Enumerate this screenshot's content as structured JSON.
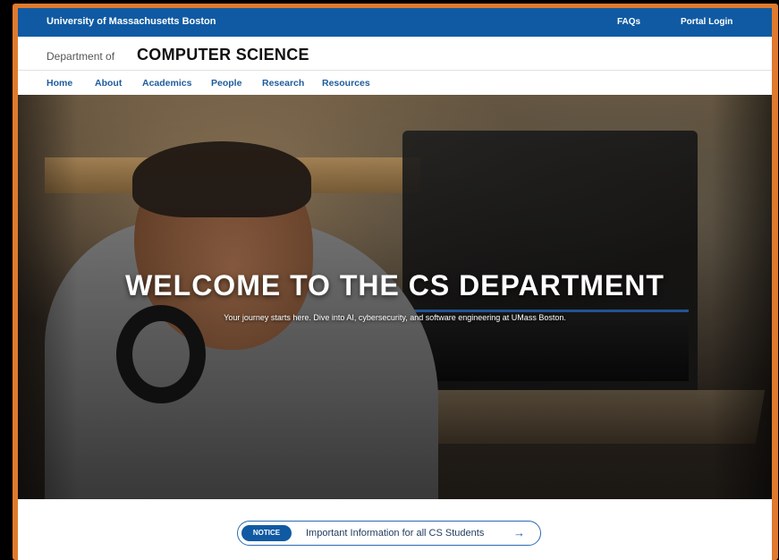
{
  "topbar": {
    "university": "University of Massachusetts Boston",
    "links": [
      {
        "label": "FAQs"
      },
      {
        "label": "Portal Login"
      }
    ]
  },
  "department": {
    "prefix": "Department of",
    "name": "COMPUTER SCIENCE"
  },
  "nav": {
    "items": [
      {
        "label": "Home"
      },
      {
        "label": "About"
      },
      {
        "label": "Academics"
      },
      {
        "label": "People"
      },
      {
        "label": "Research"
      },
      {
        "label": "Resources"
      }
    ]
  },
  "hero": {
    "title": "WELCOME TO THE CS DEPARTMENT",
    "subtitle": "Your journey starts here. Dive into AI, cybersecurity, and software engineering at UMass Boston."
  },
  "notice": {
    "badge": "NOTICE",
    "text": "Important Information for all CS Students",
    "arrow": "→"
  },
  "colors": {
    "brand_blue": "#0f5aa3",
    "link_blue": "#1f5c9c",
    "frame_orange": "#e07a2e"
  }
}
